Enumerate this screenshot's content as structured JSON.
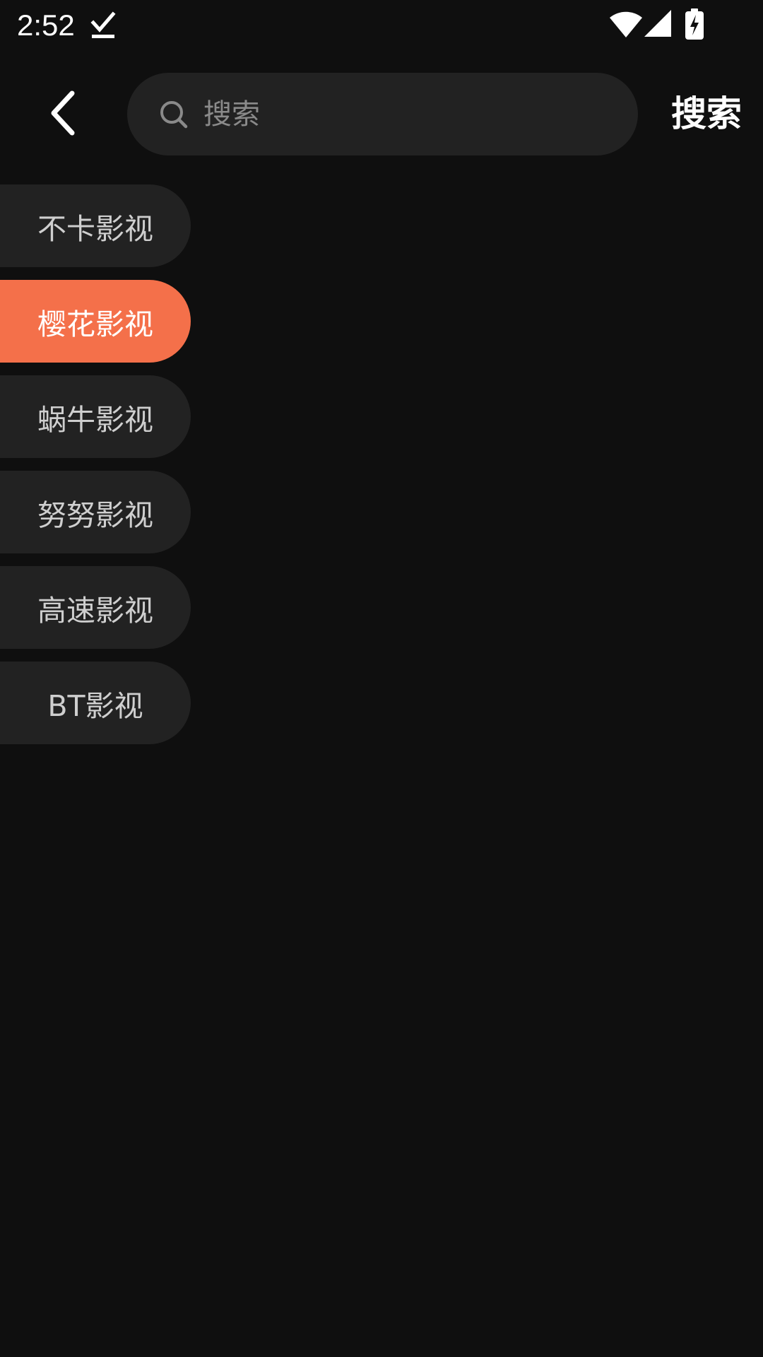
{
  "status_bar": {
    "time": "2:52",
    "icons": [
      "download-done-icon",
      "wifi-icon",
      "cell-signal-icon",
      "battery-charging-icon"
    ]
  },
  "header": {
    "back_icon": "chevron-left-icon",
    "search": {
      "placeholder": "搜索",
      "value": "",
      "icon": "search-icon"
    },
    "search_button_label": "搜索"
  },
  "sources": {
    "items": [
      {
        "label": "不卡影视",
        "selected": false
      },
      {
        "label": "樱花影视",
        "selected": true
      },
      {
        "label": "蜗牛影视",
        "selected": false
      },
      {
        "label": "努努影视",
        "selected": false
      },
      {
        "label": "高速影视",
        "selected": false
      },
      {
        "label": "BT影视",
        "selected": false
      }
    ]
  },
  "colors": {
    "background": "#0f0f0f",
    "surface": "#222222",
    "accent": "#f4704a",
    "text": "#ffffff",
    "muted_text": "#8a8a8a"
  }
}
